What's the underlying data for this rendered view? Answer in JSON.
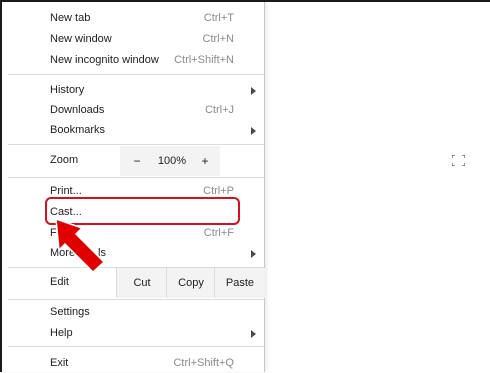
{
  "menu": {
    "new_tab": {
      "label": "New tab",
      "shortcut": "Ctrl+T"
    },
    "new_window": {
      "label": "New window",
      "shortcut": "Ctrl+N"
    },
    "new_incognito": {
      "label": "New incognito window",
      "shortcut": "Ctrl+Shift+N"
    },
    "history": {
      "label": "History"
    },
    "downloads": {
      "label": "Downloads",
      "shortcut": "Ctrl+J"
    },
    "bookmarks": {
      "label": "Bookmarks"
    },
    "zoom": {
      "label": "Zoom",
      "minus": "−",
      "value": "100%",
      "plus": "+"
    },
    "print": {
      "label": "Print...",
      "shortcut": "Ctrl+P"
    },
    "cast": {
      "label": "Cast..."
    },
    "find": {
      "label": "Fi",
      "shortcut": "Ctrl+F"
    },
    "more_tools": {
      "label": "More",
      "label_tail": "ls"
    },
    "edit": {
      "label": "Edit",
      "cut": "Cut",
      "copy": "Copy",
      "paste": "Paste"
    },
    "settings": {
      "label": "Settings"
    },
    "help": {
      "label": "Help"
    },
    "exit": {
      "label": "Exit",
      "shortcut": "Ctrl+Shift+Q"
    }
  },
  "annotation": {
    "highlight_color": "#d4111c",
    "arrow_color": "#e00000"
  },
  "icons": {
    "submenu": "chevron-right-icon",
    "fullscreen": "fullscreen-icon"
  }
}
